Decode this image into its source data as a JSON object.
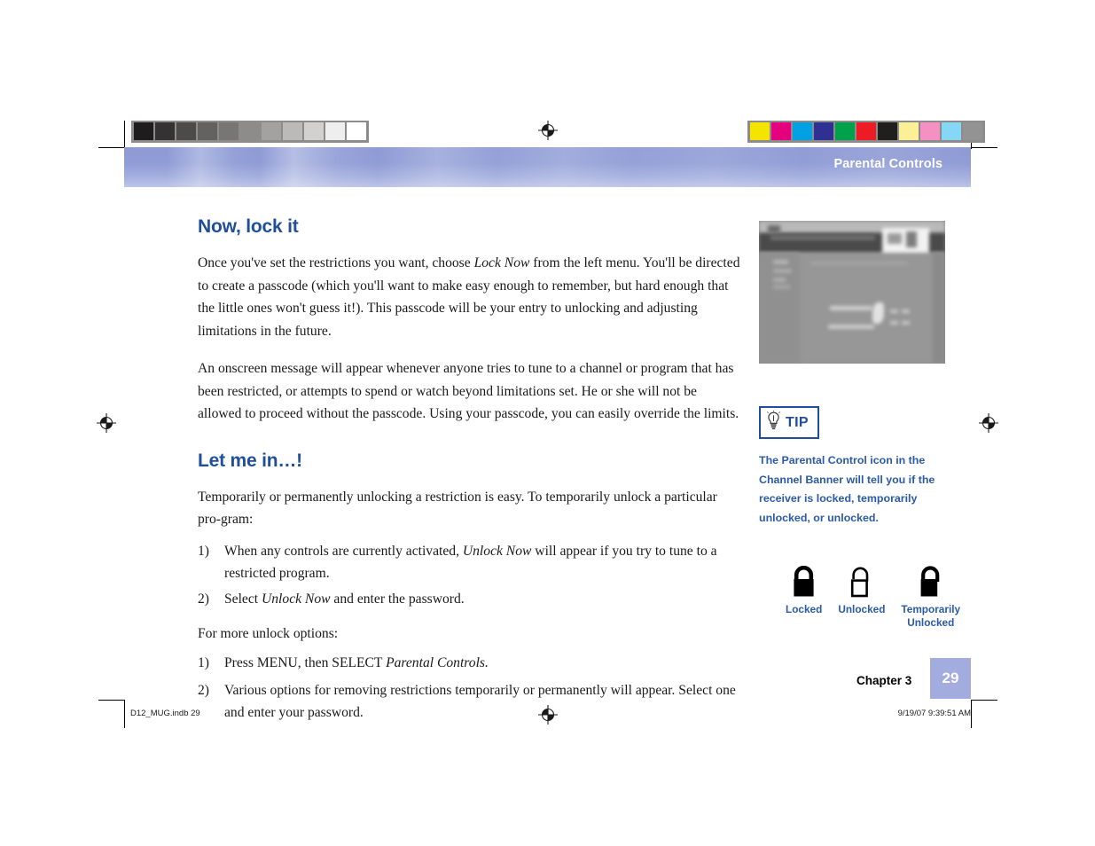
{
  "banner": {
    "title": "Parental Controls"
  },
  "content": {
    "heading_1": "Now, lock it",
    "para_1_a": "Once you've set the restrictions you want, choose ",
    "para_1_em": "Lock Now",
    "para_1_b": " from the left menu. You'll be directed to create a passcode (which you'll want to make easy enough to remember, but hard enough that the little ones won't guess it!). This passcode will be your entry to unlocking and adjusting limitations in the future.",
    "para_2": "An onscreen message will appear whenever anyone tries to tune to a channel or program that has been restricted, or attempts to spend or watch beyond limitations set. He or she will not be allowed to proceed without the passcode. Using your passcode, you can easily override the limits.",
    "heading_2": "Let me in…!",
    "para_3": "Temporarily or permanently unlocking a restriction is easy. To temporarily unlock a particular pro-gram:",
    "list_1": [
      {
        "num": "1)",
        "text_a": "When any controls are currently activated, ",
        "em": "Unlock Now",
        "text_b": " will appear if you try to tune to a restricted program."
      },
      {
        "num": "2)",
        "text_a": "Select ",
        "em": "Unlock Now",
        "text_b": " and enter the password."
      }
    ],
    "para_4": "For more unlock options:",
    "list_2": [
      {
        "num": "1)",
        "text_a": "Press MENU, then SELECT ",
        "em": "Parental Controls.",
        "text_b": ""
      },
      {
        "num": "2)",
        "text_a": "Various options for removing restrictions temporarily or permanently will appear. Select one and enter your password.",
        "em": "",
        "text_b": ""
      }
    ]
  },
  "sidebar": {
    "tip_label": "TIP",
    "tip_text": "The Parental Control icon in the Channel Banner will tell you if the receiver is locked, temporarily unlocked, or unlocked.",
    "locks": [
      {
        "caption": "Locked",
        "state": "locked"
      },
      {
        "caption": "Unlocked",
        "state": "unlocked"
      },
      {
        "caption": "Temporarily Unlocked",
        "state": "temporarily-unlocked"
      }
    ]
  },
  "footer": {
    "chapter": "Chapter 3",
    "page_number": "29",
    "print_file": "D12_MUG.indb   29",
    "print_timestamp": "9/19/07   9:39:51 AM"
  },
  "colors": {
    "heading_blue": "#1f4f9c",
    "tip_blue": "#2a5aa8",
    "banner_periwinkle": "#8f9cd6",
    "page_badge": "#a3acdf"
  },
  "calibration": {
    "grayscale_swatches": [
      "#1e1c1c",
      "#343232",
      "#4d4b4a",
      "#646260",
      "#787675",
      "#8e8c8b",
      "#a3a2a1",
      "#bbbab9",
      "#d2d1d0",
      "#eeeeee",
      "#ffffff"
    ],
    "color_swatches": [
      "#f5e400",
      "#e5007e",
      "#00a0e3",
      "#2e3192",
      "#00a14b",
      "#ed1c24",
      "#211e1e",
      "#fbef97",
      "#f490c2",
      "#86d6f5",
      "#939393"
    ]
  }
}
